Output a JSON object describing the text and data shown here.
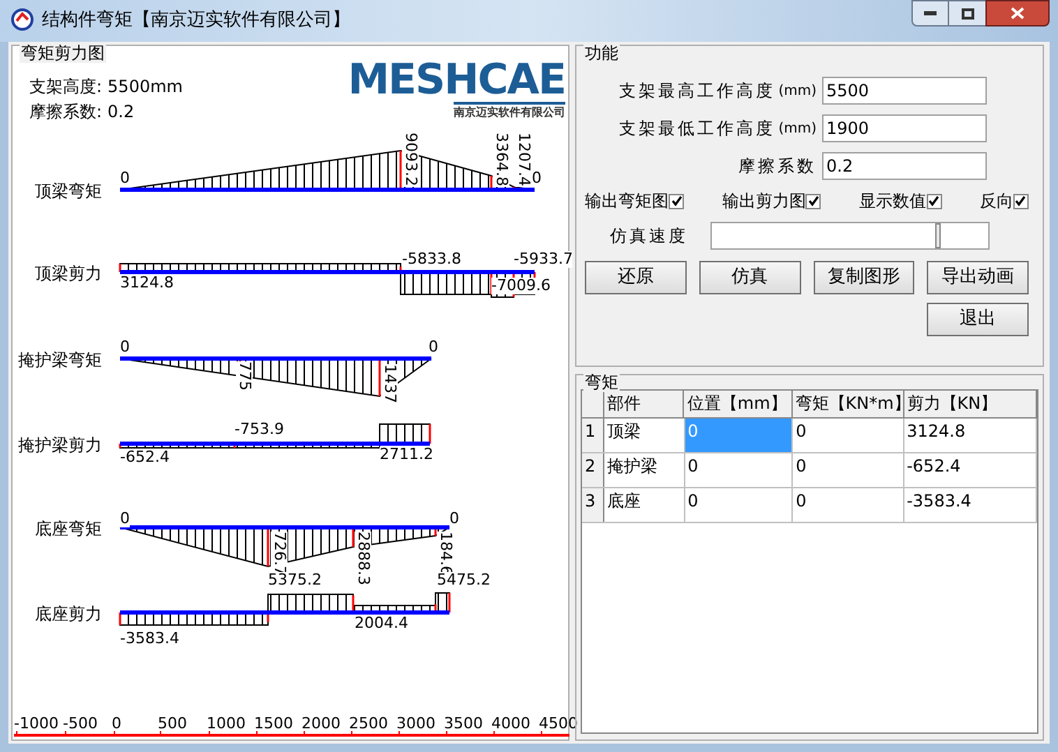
{
  "window": {
    "title": "结构件弯矩【南京迈实软件有限公司】"
  },
  "chart_panel": {
    "title": "弯矩剪力图",
    "info": [
      {
        "label": "支架高度:",
        "value": "5500mm"
      },
      {
        "label": "摩擦系数:",
        "value": "0.2"
      }
    ],
    "logo": {
      "name": "MESHCAE",
      "subtitle": "南京迈实软件有限公司"
    },
    "diagrams": [
      {
        "label": "顶梁弯矩",
        "value_labels": [
          "0",
          "9093.2",
          "3364.8",
          "1207.4",
          "0"
        ]
      },
      {
        "label": "顶梁剪力",
        "value_labels": [
          "3124.8",
          "-5833.8",
          "-7009.6",
          "-5933.7"
        ]
      },
      {
        "label": "掩护梁弯矩",
        "value_labels": [
          "0",
          "0",
          "775",
          "1437"
        ]
      },
      {
        "label": "掩护梁剪力",
        "value_labels": [
          "-753.9",
          "-652.4",
          "2711.2"
        ]
      },
      {
        "label": "底座弯矩",
        "value_labels": [
          "0",
          "0",
          "726.7",
          "2888.3",
          "184.6"
        ]
      },
      {
        "label": "底座剪力",
        "value_labels": [
          "5375.2",
          "5475.2",
          "2004.4",
          "-3583.4"
        ]
      }
    ],
    "axis_ticks": [
      "-1000",
      "-500",
      "0",
      "500",
      "1000",
      "1500",
      "2000",
      "2500",
      "3000",
      "3500",
      "4000",
      "4500"
    ]
  },
  "function_panel": {
    "title": "功能",
    "fields": [
      {
        "label": "支架最高工作高度",
        "unit": "(mm)",
        "value": "5500"
      },
      {
        "label": "支架最低工作高度",
        "unit": "(mm)",
        "value": "1900"
      },
      {
        "label": "摩擦系数",
        "value": "0.2"
      }
    ],
    "checkboxes": [
      {
        "label": "输出弯矩图",
        "checked": true
      },
      {
        "label": "输出剪力图",
        "checked": true
      },
      {
        "label": "显示数值",
        "checked": true
      },
      {
        "label": "反向",
        "checked": true
      }
    ],
    "speed": {
      "label": "仿真速度",
      "level": 0.82
    },
    "buttons": [
      "还原",
      "仿真",
      "复制图形",
      "导出动画",
      "退出"
    ]
  },
  "table_panel": {
    "title": "弯矩",
    "columns": [
      "部件",
      "位置【mm】",
      "弯矩【KN*m】",
      "剪力【KN】"
    ],
    "rows": [
      {
        "number": "1",
        "cells": [
          {
            "text": "顶梁",
            "selected": false
          },
          {
            "text": "0",
            "selected": true
          },
          {
            "text": "0",
            "selected": false
          },
          {
            "text": "3124.8",
            "selected": false
          }
        ]
      },
      {
        "number": "2",
        "cells": [
          {
            "text": "掩护梁",
            "selected": false
          },
          {
            "text": "0",
            "selected": false
          },
          {
            "text": "0",
            "selected": false
          },
          {
            "text": "-652.4",
            "selected": false
          }
        ]
      },
      {
        "number": "3",
        "cells": [
          {
            "text": "底座",
            "selected": false
          },
          {
            "text": "0",
            "selected": false
          },
          {
            "text": "0",
            "selected": false
          },
          {
            "text": "-3583.4",
            "selected": false
          }
        ]
      }
    ]
  }
}
